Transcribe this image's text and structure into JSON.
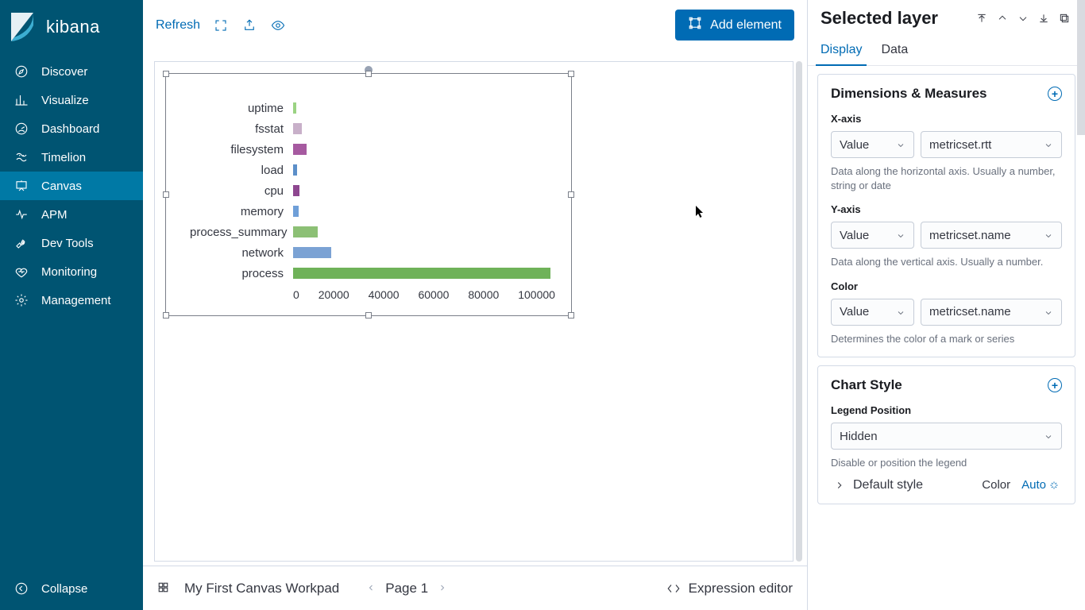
{
  "brand": "kibana",
  "nav": {
    "items": [
      {
        "label": "Discover"
      },
      {
        "label": "Visualize"
      },
      {
        "label": "Dashboard"
      },
      {
        "label": "Timelion"
      },
      {
        "label": "Canvas",
        "active": true
      },
      {
        "label": "APM"
      },
      {
        "label": "Dev Tools"
      },
      {
        "label": "Monitoring"
      },
      {
        "label": "Management"
      }
    ],
    "collapse": "Collapse"
  },
  "topbar": {
    "refresh": "Refresh",
    "add_element": "Add element"
  },
  "footer": {
    "workpad_title": "My First Canvas Workpad",
    "page_label": "Page 1",
    "expr_editor": "Expression editor"
  },
  "rightpanel": {
    "title": "Selected layer",
    "tabs": {
      "display": "Display",
      "data": "Data"
    },
    "dimensions": {
      "title": "Dimensions & Measures",
      "x_label": "X-axis",
      "x_value_sel": "Value",
      "x_field_sel": "metricset.rtt",
      "x_help": "Data along the horizontal axis. Usually a number, string or date",
      "y_label": "Y-axis",
      "y_value_sel": "Value",
      "y_field_sel": "metricset.name",
      "y_help": "Data along the vertical axis. Usually a number.",
      "color_label": "Color",
      "color_value_sel": "Value",
      "color_field_sel": "metricset.name",
      "color_help": "Determines the color of a mark or series"
    },
    "chart_style": {
      "title": "Chart Style",
      "legend_label": "Legend Position",
      "legend_value": "Hidden",
      "legend_help": "Disable or position the legend",
      "default_style": "Default style",
      "color_label": "Color",
      "auto_label": "Auto"
    }
  },
  "chart_data": {
    "type": "bar",
    "orientation": "horizontal",
    "xlabel": "",
    "ylabel": "",
    "xlim": [
      0,
      110000
    ],
    "x_ticks": [
      0,
      20000,
      40000,
      60000,
      80000,
      100000
    ],
    "categories": [
      "uptime",
      "fsstat",
      "filesystem",
      "load",
      "cpu",
      "memory",
      "process_summary",
      "network",
      "process"
    ],
    "values": [
      1200,
      3800,
      5500,
      1800,
      2600,
      2200,
      10500,
      16000,
      108000
    ],
    "colors": [
      "#9bd383",
      "#c8b0c9",
      "#a65aa0",
      "#5c8fc9",
      "#8e4790",
      "#6f9fd8",
      "#8cc075",
      "#7ba2d4",
      "#6fb259"
    ]
  }
}
